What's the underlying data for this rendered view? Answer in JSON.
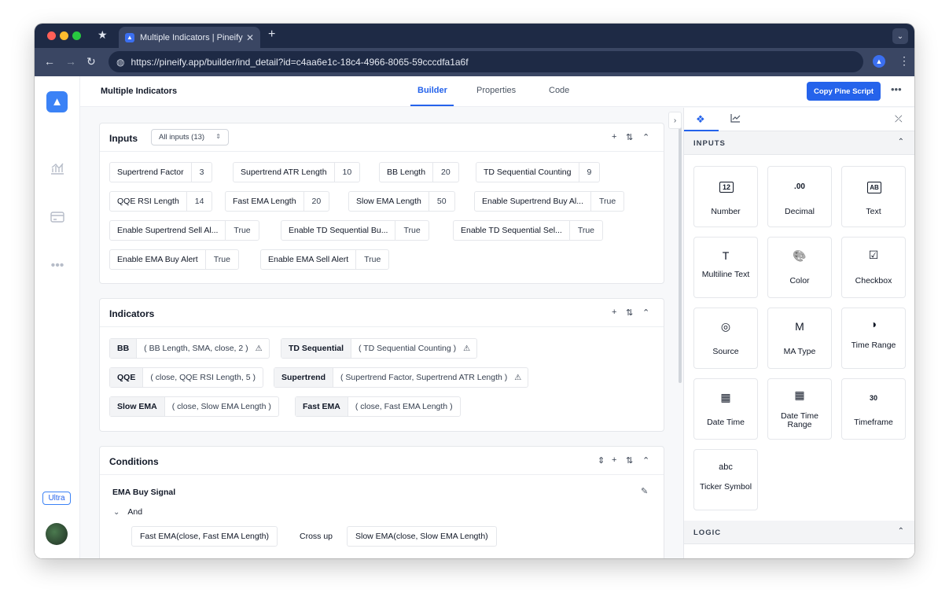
{
  "browser": {
    "tab_title": "Multiple Indicators | Pineify",
    "url": "https://pineify.app/builder/ind_detail?id=c4aa6e1c-18c4-4966-8065-59cccdfa1a6f"
  },
  "leftnav": {
    "plan_badge": "Ultra"
  },
  "header": {
    "title": "Multiple Indicators",
    "tabs": [
      "Builder",
      "Properties",
      "Code"
    ],
    "active_tab": "Builder",
    "copy_button": "Copy Pine Script"
  },
  "inputs_panel": {
    "title": "Inputs",
    "filter": "All inputs (13)",
    "chips": [
      {
        "label": "Supertrend Factor",
        "value": "3"
      },
      {
        "label": "Supertrend ATR Length",
        "value": "10"
      },
      {
        "label": "BB Length",
        "value": "20"
      },
      {
        "label": "TD Sequential Counting",
        "value": "9"
      },
      {
        "label": "QQE RSI Length",
        "value": "14"
      },
      {
        "label": "Fast EMA Length",
        "value": "20"
      },
      {
        "label": "Slow EMA Length",
        "value": "50"
      },
      {
        "label": "Enable Supertrend Buy Al...",
        "value": "True"
      },
      {
        "label": "Enable Supertrend Sell Al...",
        "value": "True"
      },
      {
        "label": "Enable TD Sequential Bu...",
        "value": "True"
      },
      {
        "label": "Enable TD Sequential Sel...",
        "value": "True"
      },
      {
        "label": "Enable EMA Buy Alert",
        "value": "True"
      },
      {
        "label": "Enable EMA Sell Alert",
        "value": "True"
      }
    ]
  },
  "indicators_panel": {
    "title": "Indicators",
    "items": [
      {
        "name": "BB",
        "params": "( BB Length, SMA, close, 2 )",
        "warn": true
      },
      {
        "name": "TD Sequential",
        "params": "( TD Sequential Counting )",
        "warn": true
      },
      {
        "name": "QQE",
        "params": "( close, QQE RSI Length, 5 )",
        "warn": false
      },
      {
        "name": "Supertrend",
        "params": "( Supertrend Factor, Supertrend ATR Length )",
        "warn": true
      },
      {
        "name": "Slow EMA",
        "params": "( close, Slow EMA Length )",
        "warn": false
      },
      {
        "name": "Fast EMA",
        "params": "( close, Fast EMA Length )",
        "warn": false
      }
    ]
  },
  "conditions_panel": {
    "title": "Conditions",
    "condition_name": "EMA Buy Signal",
    "logic": "And",
    "left": "Fast EMA(close, Fast EMA Length)",
    "operator": "Cross up",
    "right": "Slow EMA(close, Slow EMA Length)"
  },
  "sidebar": {
    "inputs_section": "INPUTS",
    "logic_section": "LOGIC",
    "tiles": [
      {
        "glyph": "12",
        "label": "Number"
      },
      {
        "glyph": ".00",
        "label": "Decimal"
      },
      {
        "glyph": "AB",
        "label": "Text"
      },
      {
        "glyph": "T",
        "label": "Multiline Text"
      },
      {
        "glyph": "🎨",
        "label": "Color"
      },
      {
        "glyph": "☑",
        "label": "Checkbox"
      },
      {
        "glyph": "◎",
        "label": "Source"
      },
      {
        "glyph": "M",
        "label": "MA Type"
      },
      {
        "glyph": "◑",
        "label": "Time Range"
      },
      {
        "glyph": "▦",
        "label": "Date Time"
      },
      {
        "glyph": "▦",
        "label": "Date Time Range"
      },
      {
        "glyph": "30",
        "label": "Timeframe"
      },
      {
        "glyph": "abc",
        "label": "Ticker Symbol"
      }
    ]
  }
}
